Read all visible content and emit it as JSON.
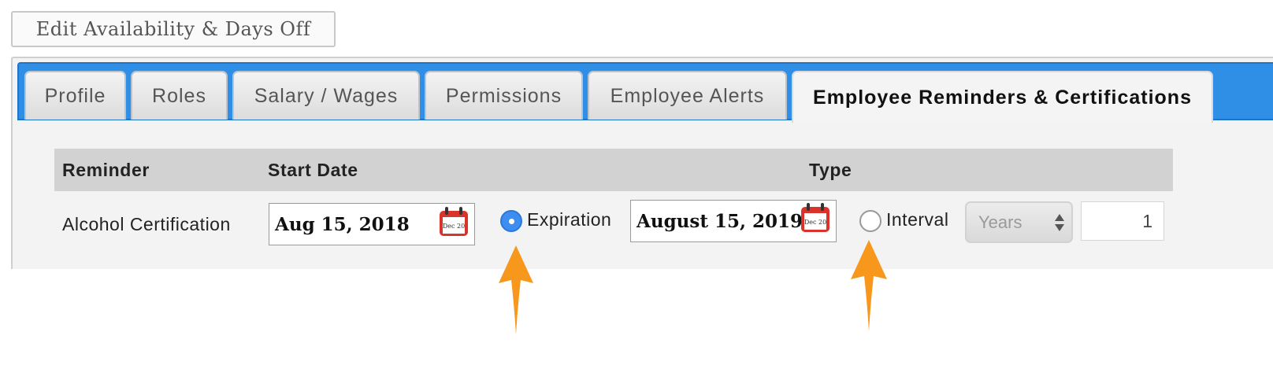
{
  "header": {
    "edit_button_label": "Edit Availability & Days Off"
  },
  "tabs": [
    {
      "label": "Profile"
    },
    {
      "label": "Roles"
    },
    {
      "label": "Salary / Wages"
    },
    {
      "label": "Permissions"
    },
    {
      "label": "Employee Alerts"
    },
    {
      "label": "Employee Reminders & Certifications",
      "active": true
    }
  ],
  "table": {
    "columns": {
      "reminder": "Reminder",
      "start_date": "Start Date",
      "type": "Type"
    },
    "row": {
      "reminder": "Alcohol Certification",
      "start_date": "Aug 15, 2018",
      "expiration_label": "Expiration",
      "expiration_date": "August 15, 2019",
      "interval_label": "Interval",
      "interval_unit": "Years",
      "interval_value": "1",
      "selected_type": "Expiration"
    }
  },
  "calendar_icon": {
    "name": "calendar-icon",
    "text": "Dec 20"
  },
  "colors": {
    "tab_bar": "#2f8ee6",
    "radio_selected": "#3d8ef0",
    "annotation_arrow": "#f7981d",
    "calendar_red": "#d9342b"
  }
}
